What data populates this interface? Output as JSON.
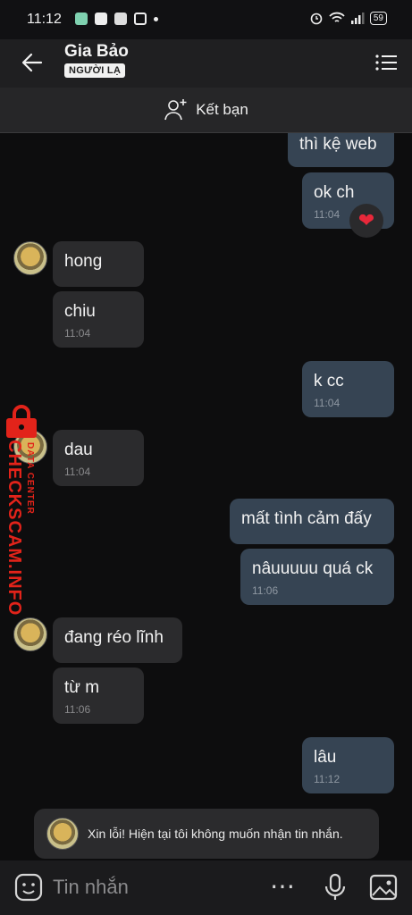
{
  "status": {
    "time": "11:12",
    "battery": "59"
  },
  "header": {
    "name": "Gia Bảo",
    "badge": "NGƯỜI LẠ"
  },
  "add_friend": {
    "label": "Kết bạn"
  },
  "messages": [
    {
      "dir": "out",
      "text": "thì kệ web",
      "time": ""
    },
    {
      "dir": "out",
      "text": "ok ch",
      "time": "11:04"
    },
    {
      "dir": "in",
      "text": "hong",
      "time": ""
    },
    {
      "dir": "in",
      "text": "chiu",
      "time": "11:04"
    },
    {
      "dir": "out",
      "text": "k cc",
      "time": "11:04"
    },
    {
      "dir": "in",
      "text": "dau",
      "time": "11:04"
    },
    {
      "dir": "out",
      "text": "mất tình cảm đấy",
      "time": ""
    },
    {
      "dir": "out",
      "text": "nâuuuuu quá ck",
      "time": "11:06"
    },
    {
      "dir": "in",
      "text": "đang réo lĩnh",
      "time": ""
    },
    {
      "dir": "in",
      "text": "từ m",
      "time": "11:06"
    },
    {
      "dir": "out",
      "text": "lâu",
      "time": "11:12"
    }
  ],
  "reaction": {
    "icon": "heart-icon",
    "glyph": "❤"
  },
  "watermark": {
    "main": "CHECKSCAM.INFO",
    "sub": "DATA CENTER"
  },
  "auto_reply": {
    "text": "Xin lỗi! Hiện tại tôi không muốn nhận tin nhắn."
  },
  "composer": {
    "placeholder": "Tin nhắn",
    "more": "⋯"
  },
  "colors": {
    "outgoing": "#364453",
    "incoming": "#2b2b2d",
    "background": "#0d0d0e",
    "watermark": "#e2231a"
  }
}
